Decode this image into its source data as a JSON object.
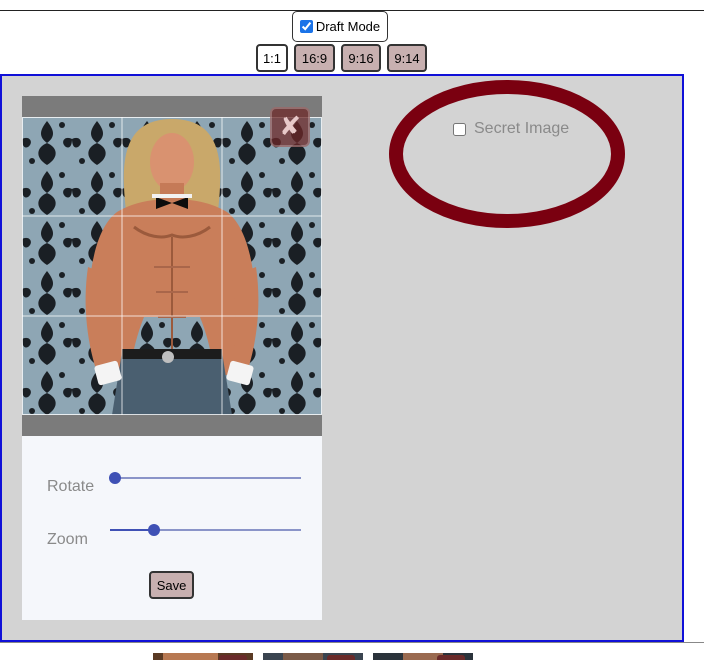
{
  "header": {
    "draft_mode": {
      "label": "Draft Mode",
      "checked": true
    },
    "ratios": [
      {
        "label": "1:1",
        "active": true
      },
      {
        "label": "16:9",
        "active": false
      },
      {
        "label": "9:16",
        "active": false
      },
      {
        "label": "9:14",
        "active": false
      }
    ]
  },
  "editor": {
    "close_icon": "close-icon",
    "close_glyph": "✘",
    "rotate_label": "Rotate",
    "rotate_value": 0,
    "zoom_label": "Zoom",
    "zoom_value": 0.23,
    "save_label": "Save"
  },
  "secret": {
    "label": "Secret Image",
    "checked": false
  },
  "colors": {
    "panel_border": "#1010d8",
    "panel_bg": "#d3d3d3",
    "oval": "#7a0010",
    "slider": "#3f51b5",
    "button_bg": "#c8b0b0"
  },
  "thumbnails_count": 3
}
